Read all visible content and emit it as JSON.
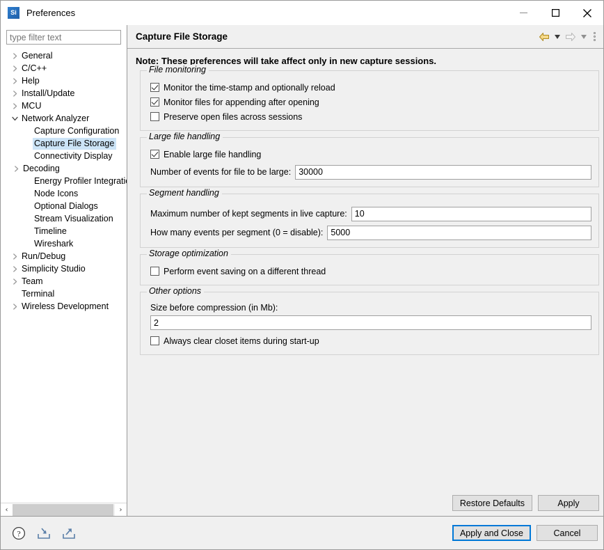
{
  "window": {
    "app_icon_text": "Si",
    "title": "Preferences",
    "buttons": {
      "minimize": "minimize-button",
      "maximize": "maximize-button",
      "close": "close-button"
    }
  },
  "sidebar": {
    "filter": {
      "placeholder": "type filter text",
      "value": ""
    },
    "items": [
      {
        "label": "General",
        "level": 0,
        "expandable": true,
        "expanded": false,
        "selected": false
      },
      {
        "label": "C/C++",
        "level": 0,
        "expandable": true,
        "expanded": false,
        "selected": false
      },
      {
        "label": "Help",
        "level": 0,
        "expandable": true,
        "expanded": false,
        "selected": false
      },
      {
        "label": "Install/Update",
        "level": 0,
        "expandable": true,
        "expanded": false,
        "selected": false
      },
      {
        "label": "MCU",
        "level": 0,
        "expandable": true,
        "expanded": false,
        "selected": false
      },
      {
        "label": "Network Analyzer",
        "level": 0,
        "expandable": true,
        "expanded": true,
        "selected": false
      },
      {
        "label": "Capture Configuration",
        "level": 1,
        "expandable": false,
        "expanded": false,
        "selected": false
      },
      {
        "label": "Capture File Storage",
        "level": 1,
        "expandable": false,
        "expanded": false,
        "selected": true
      },
      {
        "label": "Connectivity Display",
        "level": 1,
        "expandable": false,
        "expanded": false,
        "selected": false
      },
      {
        "label": "Decoding",
        "level": 1,
        "expandable": true,
        "expanded": false,
        "selected": false
      },
      {
        "label": "Energy Profiler Integration",
        "level": 1,
        "expandable": false,
        "expanded": false,
        "selected": false
      },
      {
        "label": "Node Icons",
        "level": 1,
        "expandable": false,
        "expanded": false,
        "selected": false
      },
      {
        "label": "Optional Dialogs",
        "level": 1,
        "expandable": false,
        "expanded": false,
        "selected": false
      },
      {
        "label": "Stream Visualization",
        "level": 1,
        "expandable": false,
        "expanded": false,
        "selected": false
      },
      {
        "label": "Timeline",
        "level": 1,
        "expandable": false,
        "expanded": false,
        "selected": false
      },
      {
        "label": "Wireshark",
        "level": 1,
        "expandable": false,
        "expanded": false,
        "selected": false
      },
      {
        "label": "Run/Debug",
        "level": 0,
        "expandable": true,
        "expanded": false,
        "selected": false
      },
      {
        "label": "Simplicity Studio",
        "level": 0,
        "expandable": true,
        "expanded": false,
        "selected": false
      },
      {
        "label": "Team",
        "level": 0,
        "expandable": true,
        "expanded": false,
        "selected": false
      },
      {
        "label": "Terminal",
        "level": 0,
        "expandable": false,
        "expanded": false,
        "selected": false
      },
      {
        "label": "Wireless Development",
        "level": 0,
        "expandable": true,
        "expanded": false,
        "selected": false
      }
    ],
    "hscroll": {
      "left_arrow": "‹",
      "right_arrow": "›"
    }
  },
  "page": {
    "title": "Capture File Storage",
    "nav": {
      "back": "back-arrow",
      "back_caret": "▾",
      "forward": "forward-arrow",
      "forward_caret": "▾",
      "menu": "view-menu"
    },
    "note": "Note: These preferences will take affect only in new capture sessions.",
    "groups": [
      {
        "legend": "File monitoring",
        "checkboxes": [
          {
            "label": "Monitor the time-stamp and optionally reload",
            "checked": true
          },
          {
            "label": "Monitor files for appending after opening",
            "checked": true
          },
          {
            "label": "Preserve open files across sessions",
            "checked": false
          }
        ]
      },
      {
        "legend": "Large file handling",
        "checkboxes": [
          {
            "label": "Enable large file handling",
            "checked": true
          }
        ],
        "fields": [
          {
            "label": "Number of events for file to be large:",
            "value": "30000"
          }
        ]
      },
      {
        "legend": "Segment handling",
        "fields": [
          {
            "label": "Maximum number of kept segments in live capture:",
            "value": "10"
          },
          {
            "label": "How many events per segment (0 = disable):",
            "value": "5000"
          }
        ]
      },
      {
        "legend": "Storage optimization",
        "checkboxes": [
          {
            "label": "Perform event saving on a different thread",
            "checked": false
          }
        ]
      },
      {
        "legend": "Other options",
        "stacked_field": {
          "label": "Size before compression (in Mb):",
          "value": "2"
        },
        "checkboxes": [
          {
            "label": "Always clear closet items during start-up",
            "checked": false
          }
        ]
      }
    ],
    "buttons": {
      "restore_defaults": "Restore Defaults",
      "apply": "Apply"
    }
  },
  "footer": {
    "icons": {
      "help": "help-icon",
      "import": "import-icon",
      "export": "export-icon"
    },
    "buttons": {
      "apply_and_close": "Apply and Close",
      "cancel": "Cancel"
    }
  },
  "colors": {
    "accent": "#0078d7",
    "selection": "#cce4f7",
    "chrome": "#f0f0f0"
  }
}
